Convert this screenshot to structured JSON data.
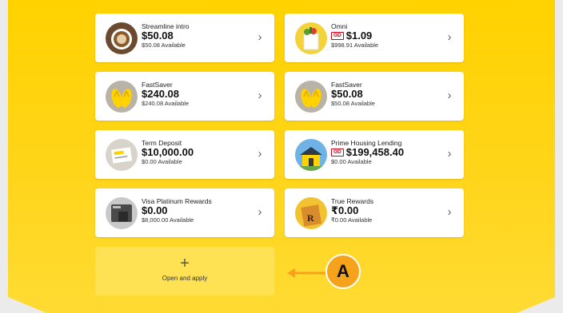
{
  "accounts": [
    {
      "name": "Streamline intro",
      "badge": "",
      "balance": "$50.08",
      "available": "$50.08  Available",
      "icon": "coffee-cup-icon"
    },
    {
      "name": "Omni",
      "badge": "OD",
      "balance": "$1.09",
      "available": "$998.91  Available",
      "icon": "shopping-bag-icon"
    },
    {
      "name": "FastSaver",
      "badge": "",
      "balance": "$240.08",
      "available": "$240.08  Available",
      "icon": "jandals-icon"
    },
    {
      "name": "FastSaver",
      "badge": "",
      "balance": "$50.08",
      "available": "$50.08  Available",
      "icon": "jandals-icon"
    },
    {
      "name": "Term Deposit",
      "badge": "",
      "balance": "$10,000.00",
      "available": "$0.00  Available",
      "icon": "document-icon"
    },
    {
      "name": "Prime Housing Lending",
      "badge": "OD",
      "balance": "$199,458.40",
      "available": "$0.00  Available",
      "icon": "house-icon"
    },
    {
      "name": "Visa Platinum Rewards",
      "badge": "",
      "balance": "$0.00",
      "available": "$8,000.00  Available",
      "icon": "credit-card-icon"
    },
    {
      "name": "True Rewards",
      "badge": "",
      "balance": "₹0.00",
      "available": "₹0.00  Available",
      "icon": "rewards-bag-icon"
    }
  ],
  "chevron": "›",
  "open_apply": {
    "plus": "+",
    "label": "Open and apply"
  },
  "callout": {
    "letter": "A",
    "color": "#f7a21b"
  },
  "colors": {
    "background": "#ffd200",
    "card": "#ffffff",
    "od_badge": "#d0021b"
  }
}
